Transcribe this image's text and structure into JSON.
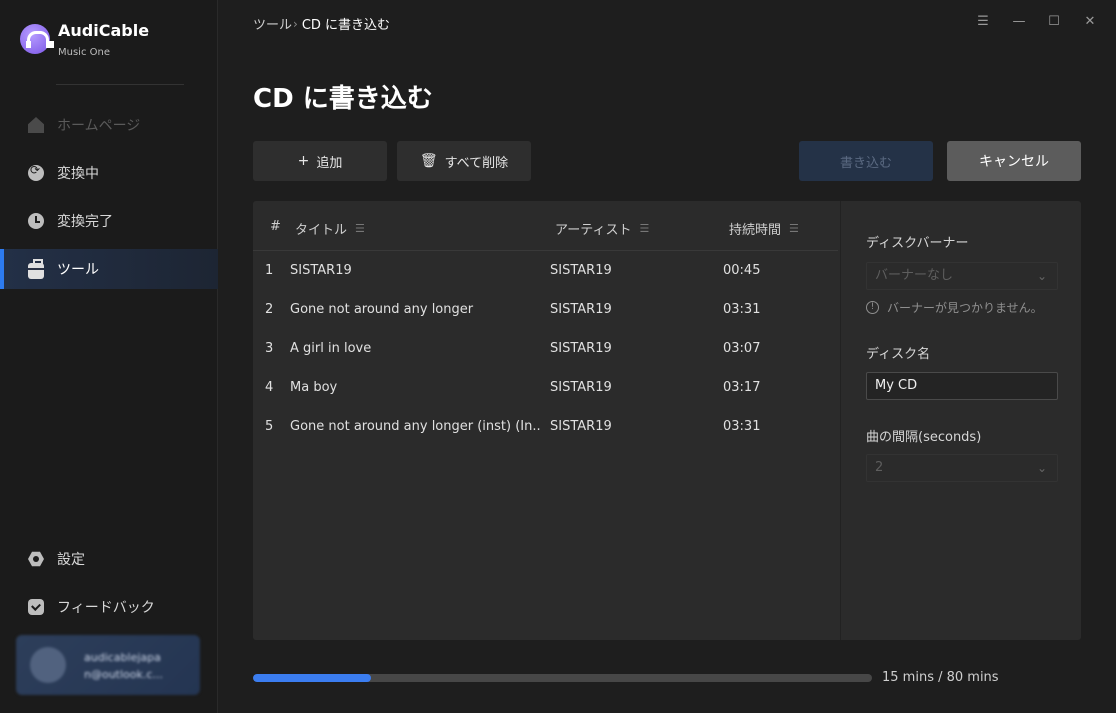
{
  "app": {
    "name": "AudiCable",
    "subtitle": "Music One"
  },
  "sidebar": {
    "items": [
      {
        "label": "ホームページ",
        "icon": "home-icon",
        "state": "disabled"
      },
      {
        "label": "変換中",
        "icon": "converting-icon",
        "state": "normal"
      },
      {
        "label": "変換完了",
        "icon": "clock-icon",
        "state": "normal"
      },
      {
        "label": "ツール",
        "icon": "toolbox-icon",
        "state": "active"
      }
    ],
    "bottom": [
      {
        "label": "設定",
        "icon": "settings-icon"
      },
      {
        "label": "フィードバック",
        "icon": "feedback-icon"
      }
    ],
    "account": {
      "line1": "audicablejapa",
      "line2": "n@outlook.c..."
    }
  },
  "breadcrumb": {
    "parent": "ツール",
    "separator": "›",
    "current": "CD に書き込む"
  },
  "window_controls": [
    "menu-icon",
    "minimize-icon",
    "maximize-icon",
    "close-icon"
  ],
  "page": {
    "title": "CD に書き込む"
  },
  "toolbar": {
    "add_label": "追加",
    "delete_all_label": "すべて削除",
    "burn_label": "書き込む",
    "cancel_label": "キャンセル"
  },
  "table": {
    "headers": {
      "num": "#",
      "title": "タイトル",
      "artist": "アーティスト",
      "duration": "持続時間"
    },
    "rows": [
      {
        "num": "1",
        "title": "SISTAR19",
        "artist": "SISTAR19",
        "duration": "00:45"
      },
      {
        "num": "2",
        "title": "Gone not around any longer",
        "artist": "SISTAR19",
        "duration": "03:31"
      },
      {
        "num": "3",
        "title": "A girl in love",
        "artist": "SISTAR19",
        "duration": "03:07"
      },
      {
        "num": "4",
        "title": "Ma boy",
        "artist": "SISTAR19",
        "duration": "03:17"
      },
      {
        "num": "5",
        "title": "Gone not around any longer (inst) (In...",
        "artist": "SISTAR19",
        "duration": "03:31"
      }
    ]
  },
  "settings_panel": {
    "banner_label": "ディスクバーナー",
    "banner_value": "バーナーなし",
    "banner_hint": "バーナーが見つかりません。",
    "disc_name_label": "ディスク名",
    "disc_name_value": "My CD",
    "gap_label": "曲の間隔(seconds)",
    "gap_value": "2"
  },
  "progress": {
    "text": "15 mins / 80 mins",
    "fraction": 0.19
  },
  "colors": {
    "accent": "#3b7df0",
    "active_nav": "#2d7bf0",
    "brand": "#8b68ee"
  }
}
